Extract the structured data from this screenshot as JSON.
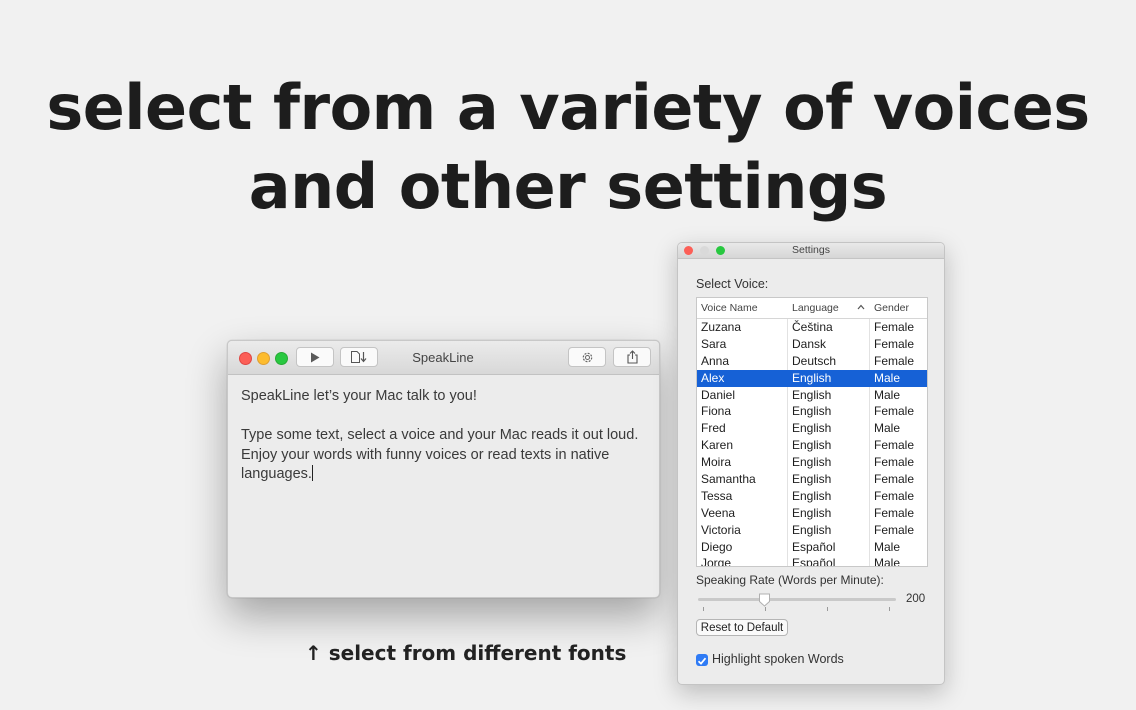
{
  "headline": {
    "line1": "select from a variety of voices",
    "line2": "and other settings"
  },
  "caption": "↑ select from different fonts",
  "main_window": {
    "title": "SpeakLine",
    "text_line1": "SpeakLine let’s your Mac talk to you!",
    "text_para2": "Type some text, select a voice and your Mac reads it out loud. Enjoy your words with funny voices or read texts in native languages.",
    "toolbar_icons": [
      "play-icon",
      "export-audio-icon",
      "gear-icon",
      "share-icon"
    ]
  },
  "settings_window": {
    "title": "Settings",
    "select_voice_label": "Select Voice:",
    "columns": [
      "Voice Name",
      "Language",
      "Gender"
    ],
    "sort_indicator": "^",
    "voices": [
      {
        "name": "Zuzana",
        "language": "Čeština",
        "gender": "Female"
      },
      {
        "name": "Sara",
        "language": "Dansk",
        "gender": "Female"
      },
      {
        "name": "Anna",
        "language": "Deutsch",
        "gender": "Female"
      },
      {
        "name": "Alex",
        "language": "English",
        "gender": "Male"
      },
      {
        "name": "Daniel",
        "language": "English",
        "gender": "Male"
      },
      {
        "name": "Fiona",
        "language": "English",
        "gender": "Female"
      },
      {
        "name": "Fred",
        "language": "English",
        "gender": "Male"
      },
      {
        "name": "Karen",
        "language": "English",
        "gender": "Female"
      },
      {
        "name": "Moira",
        "language": "English",
        "gender": "Female"
      },
      {
        "name": "Samantha",
        "language": "English",
        "gender": "Female"
      },
      {
        "name": "Tessa",
        "language": "English",
        "gender": "Female"
      },
      {
        "name": "Veena",
        "language": "English",
        "gender": "Female"
      },
      {
        "name": "Victoria",
        "language": "English",
        "gender": "Female"
      },
      {
        "name": "Diego",
        "language": "Español",
        "gender": "Male"
      },
      {
        "name": "Jorge",
        "language": "Español",
        "gender": "Male"
      }
    ],
    "selected_voice": "Alex",
    "rate_label": "Speaking Rate (Words per Minute):",
    "rate_value": "200",
    "reset_label": "Reset to Default",
    "highlight_label": "Highlight spoken Words",
    "highlight_checked": true,
    "selection_color": "#1661d6"
  }
}
